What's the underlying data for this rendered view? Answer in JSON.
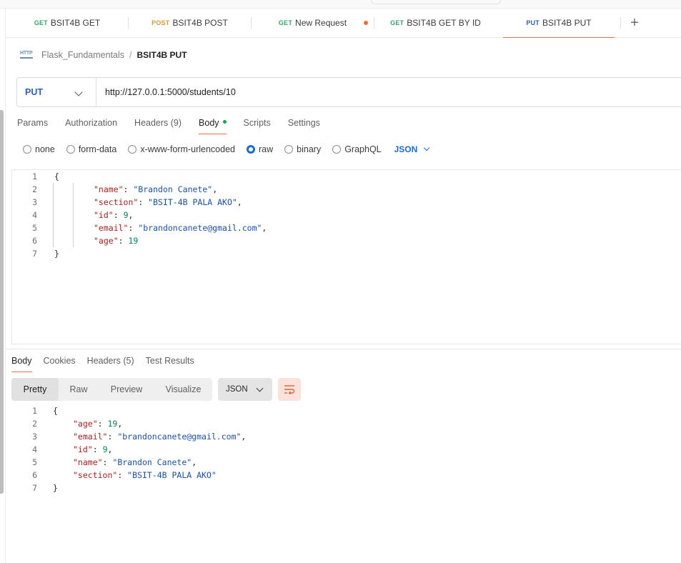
{
  "tabs": [
    {
      "method": "GET",
      "name": "BSIT4B GET"
    },
    {
      "method": "POST",
      "name": "BSIT4B POST"
    },
    {
      "method": "GET",
      "name": "New Request"
    },
    {
      "method": "GET",
      "name": "BSIT4B GET BY ID"
    },
    {
      "method": "PUT",
      "name": "BSIT4B PUT"
    }
  ],
  "http_icon_text": "HTTP",
  "breadcrumb": {
    "collection": "Flask_Fundamentals",
    "separator": "/",
    "current": "BSIT4B PUT"
  },
  "request": {
    "method": "PUT",
    "url": "http://127.0.0.1:5000/students/10"
  },
  "request_tabs": [
    "Params",
    "Authorization",
    "Headers (9)",
    "Body",
    "Scripts",
    "Settings"
  ],
  "body_options": [
    "none",
    "form-data",
    "x-www-form-urlencoded",
    "raw",
    "binary",
    "GraphQL"
  ],
  "body_selected": "raw",
  "body_format": "JSON",
  "request_body_lines": [
    {
      "n": "1",
      "open": "{"
    },
    {
      "n": "2",
      "key": "\"name\"",
      "value": "\"Brandon Canete\"",
      "type": "s",
      "comma": ","
    },
    {
      "n": "3",
      "key": "\"section\"",
      "value": "\"BSIT-4B PALA AKO\"",
      "type": "s",
      "comma": ","
    },
    {
      "n": "4",
      "key": "\"id\"",
      "value": "9",
      "type": "n",
      "comma": ","
    },
    {
      "n": "5",
      "key": "\"email\"",
      "value": "\"brandoncanete@gmail.com\"",
      "type": "s",
      "comma": ","
    },
    {
      "n": "6",
      "key": "\"age\"",
      "value": "19",
      "type": "n",
      "comma": ""
    },
    {
      "n": "7",
      "open": "}"
    }
  ],
  "response_tabs": [
    "Body",
    "Cookies",
    "Headers (5)",
    "Test Results"
  ],
  "response_views": [
    "Pretty",
    "Raw",
    "Preview",
    "Visualize"
  ],
  "response_format": "JSON",
  "response_body_lines": [
    {
      "n": "1",
      "open": "{"
    },
    {
      "n": "2",
      "key": "\"age\"",
      "value": "19",
      "type": "n",
      "comma": ","
    },
    {
      "n": "3",
      "key": "\"email\"",
      "value": "\"brandoncanete@gmail.com\"",
      "type": "s",
      "comma": ","
    },
    {
      "n": "4",
      "key": "\"id\"",
      "value": "9",
      "type": "n",
      "comma": ","
    },
    {
      "n": "5",
      "key": "\"name\"",
      "value": "\"Brandon Canete\"",
      "type": "s",
      "comma": ","
    },
    {
      "n": "6",
      "key": "\"section\"",
      "value": "\"BSIT-4B PALA AKO\"",
      "type": "s",
      "comma": ""
    },
    {
      "n": "7",
      "open": "}"
    }
  ],
  "colors": {
    "accent": "#ef6e45",
    "get": "#3f9e6c",
    "post": "#d19b3f",
    "put": "#2d5fb4",
    "link": "#1b6dd6"
  }
}
